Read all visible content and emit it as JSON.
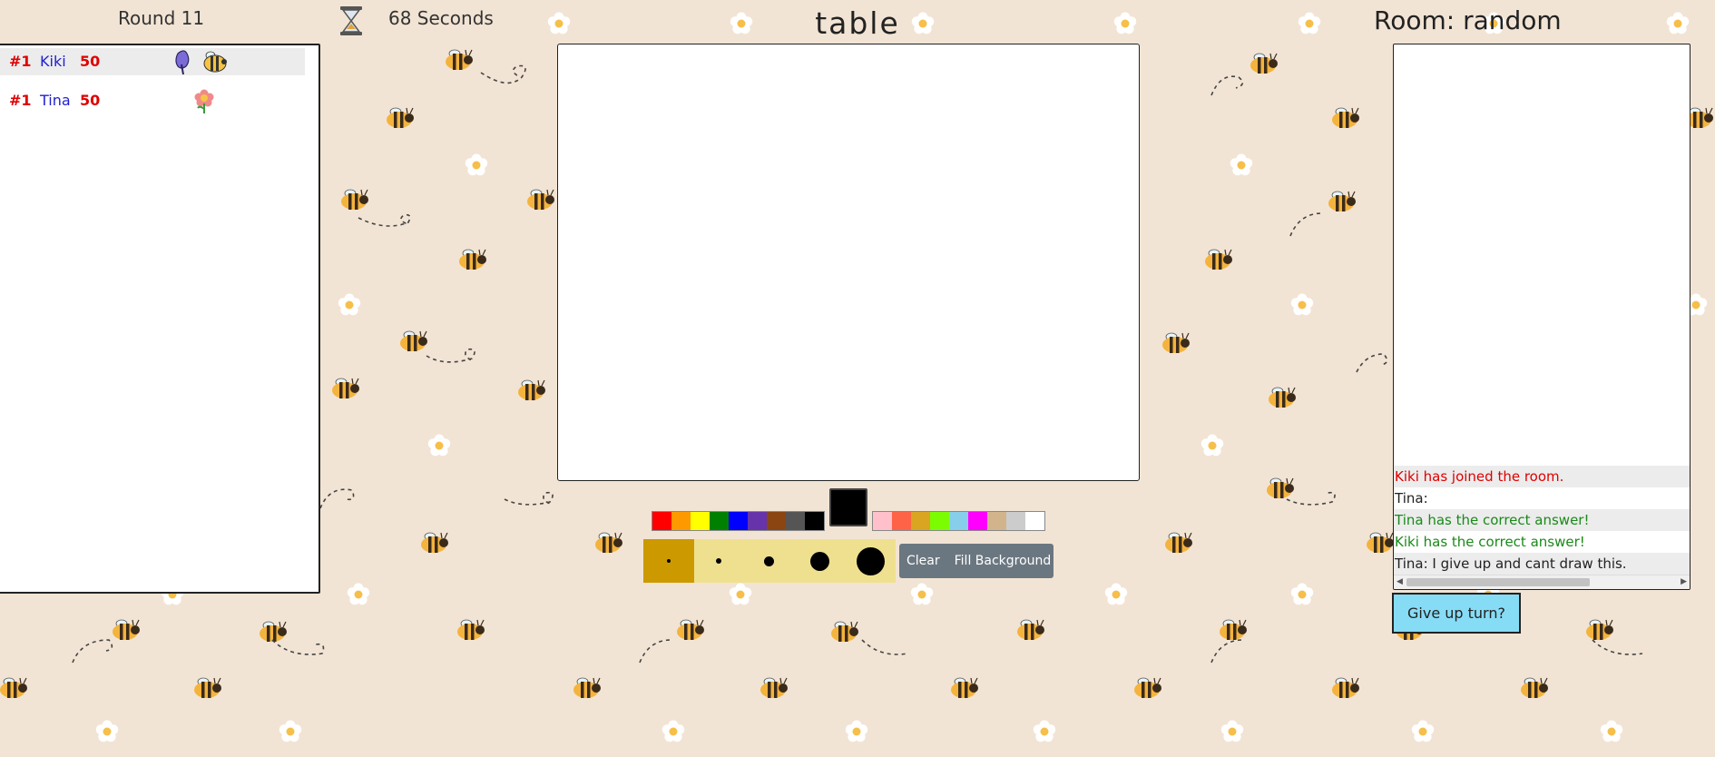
{
  "header": {
    "round": "Round 11",
    "seconds": "68 Seconds",
    "word": "table",
    "room": "Room: random"
  },
  "icons": {
    "timer": "hourglass-icon",
    "drawer": "paintbrush-icon",
    "guessed": "bee-icon",
    "player": "flower-icon"
  },
  "scoreboard": {
    "players": [
      {
        "rank": "#1",
        "name": "Kiki",
        "score": "50",
        "badges": [
          "paintbrush-icon",
          "bee-icon"
        ]
      },
      {
        "rank": "#1",
        "name": "Tina",
        "score": "50",
        "badges": [
          "flower-icon"
        ]
      }
    ]
  },
  "palette": {
    "primary": [
      "#ff0000",
      "#ff9900",
      "#ffff00",
      "#008000",
      "#0000ff",
      "#6633aa",
      "#8b4513",
      "#555555",
      "#000000"
    ],
    "secondary": [
      "#ffc0cb",
      "#ff6347",
      "#daa520",
      "#7cfc00",
      "#87ceeb",
      "#ff00ff",
      "#d2b48c",
      "#cccccc",
      "#ffffff"
    ],
    "current_color": "#000000"
  },
  "brushes": {
    "sizes": [
      "extra-small",
      "small",
      "medium",
      "large",
      "extra-large"
    ],
    "selected": "extra-small"
  },
  "tools": {
    "clear_label": "Clear",
    "fill_label": "Fill Background"
  },
  "chat": {
    "messages": [
      {
        "text": "Kiki has joined the room.",
        "color": "red"
      },
      {
        "text": "Tina:",
        "color": "black"
      },
      {
        "text": "Tina has the correct answer!",
        "color": "green"
      },
      {
        "text": "Kiki has the correct answer!",
        "color": "green"
      },
      {
        "text": "Tina: I give up and cant draw this.",
        "color": "black"
      }
    ]
  },
  "give_up_label": "Give up turn?",
  "colors": {
    "background": "#f2e4d4",
    "brush_active": "#cc9900",
    "brush_bar": "#efe08f",
    "give_up": "#87dcf5",
    "rank": "#e00000",
    "player_name": "#1f1fd0"
  }
}
